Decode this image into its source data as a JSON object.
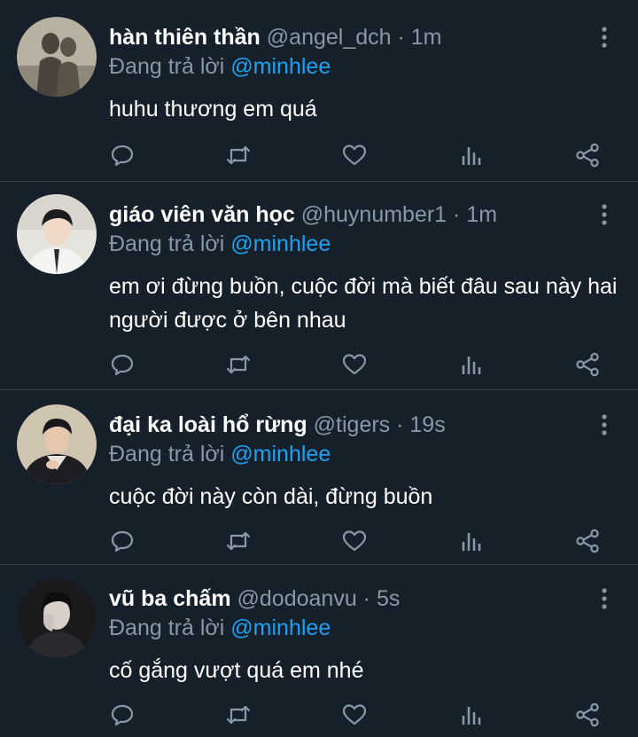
{
  "reply_prefix": "Đang trả lời",
  "colors": {
    "background": "#15202b",
    "muted": "#8899a6",
    "mention": "#1da1f2",
    "divider": "#38444d"
  },
  "icons": [
    "more-vert-icon",
    "reply-icon",
    "retweet-icon",
    "like-icon",
    "analytics-icon",
    "share-icon"
  ],
  "tweets": [
    {
      "name": "hàn thiên thần",
      "handle": "@angel_dch",
      "time": "1m",
      "reply_to": "@minhlee",
      "text": "huhu thương em quá"
    },
    {
      "name": "giáo viên văn học",
      "handle": "@huynumber1",
      "time": "1m",
      "reply_to": "@minhlee",
      "text": "em ơi đừng buồn, cuộc đời mà biết đâu sau này hai người được ở bên nhau"
    },
    {
      "name": "đại ka loài hổ rừng",
      "handle": "@tigers",
      "time": "19s",
      "reply_to": "@minhlee",
      "text": "cuộc đời này còn dài, đừng buồn"
    },
    {
      "name": "vũ ba chấm",
      "handle": "@dodoanvu",
      "time": "5s",
      "reply_to": "@minhlee",
      "text": "cố gắng vượt quá em nhé"
    }
  ]
}
